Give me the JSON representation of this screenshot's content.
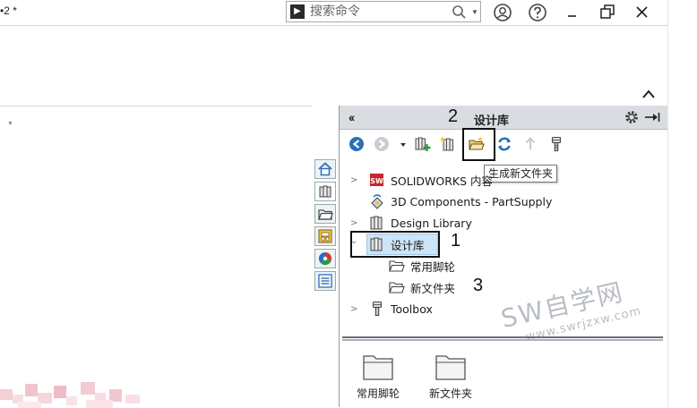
{
  "window": {
    "title": "•2 *",
    "search_placeholder": "搜索命令"
  },
  "panel": {
    "title": "设计库",
    "tooltip": "生成新文件夹",
    "tree": [
      {
        "label": "SOLIDWORKS 内容",
        "expander": ">"
      },
      {
        "label": "3D Components - PartSupply",
        "expander": ""
      },
      {
        "label": "Design Library",
        "expander": ">"
      },
      {
        "label": "设计库",
        "expander": "⌄"
      },
      {
        "label": "常用脚轮",
        "expander": ""
      },
      {
        "label": "新文件夹",
        "expander": ""
      },
      {
        "label": "Toolbox",
        "expander": ">"
      }
    ],
    "bottom_items": [
      {
        "label": "常用脚轮"
      },
      {
        "label": "新文件夹"
      }
    ]
  },
  "callouts": [
    "1",
    "2",
    "3"
  ],
  "watermark": {
    "main": "SW自学网",
    "sub": "www.swrjzxw.com"
  },
  "colors": {
    "panel_header": "#d9dde2",
    "selection": "#cde4f7",
    "accent_blue": "#2a6fb8",
    "folder_yellow": "#f3d27a"
  }
}
